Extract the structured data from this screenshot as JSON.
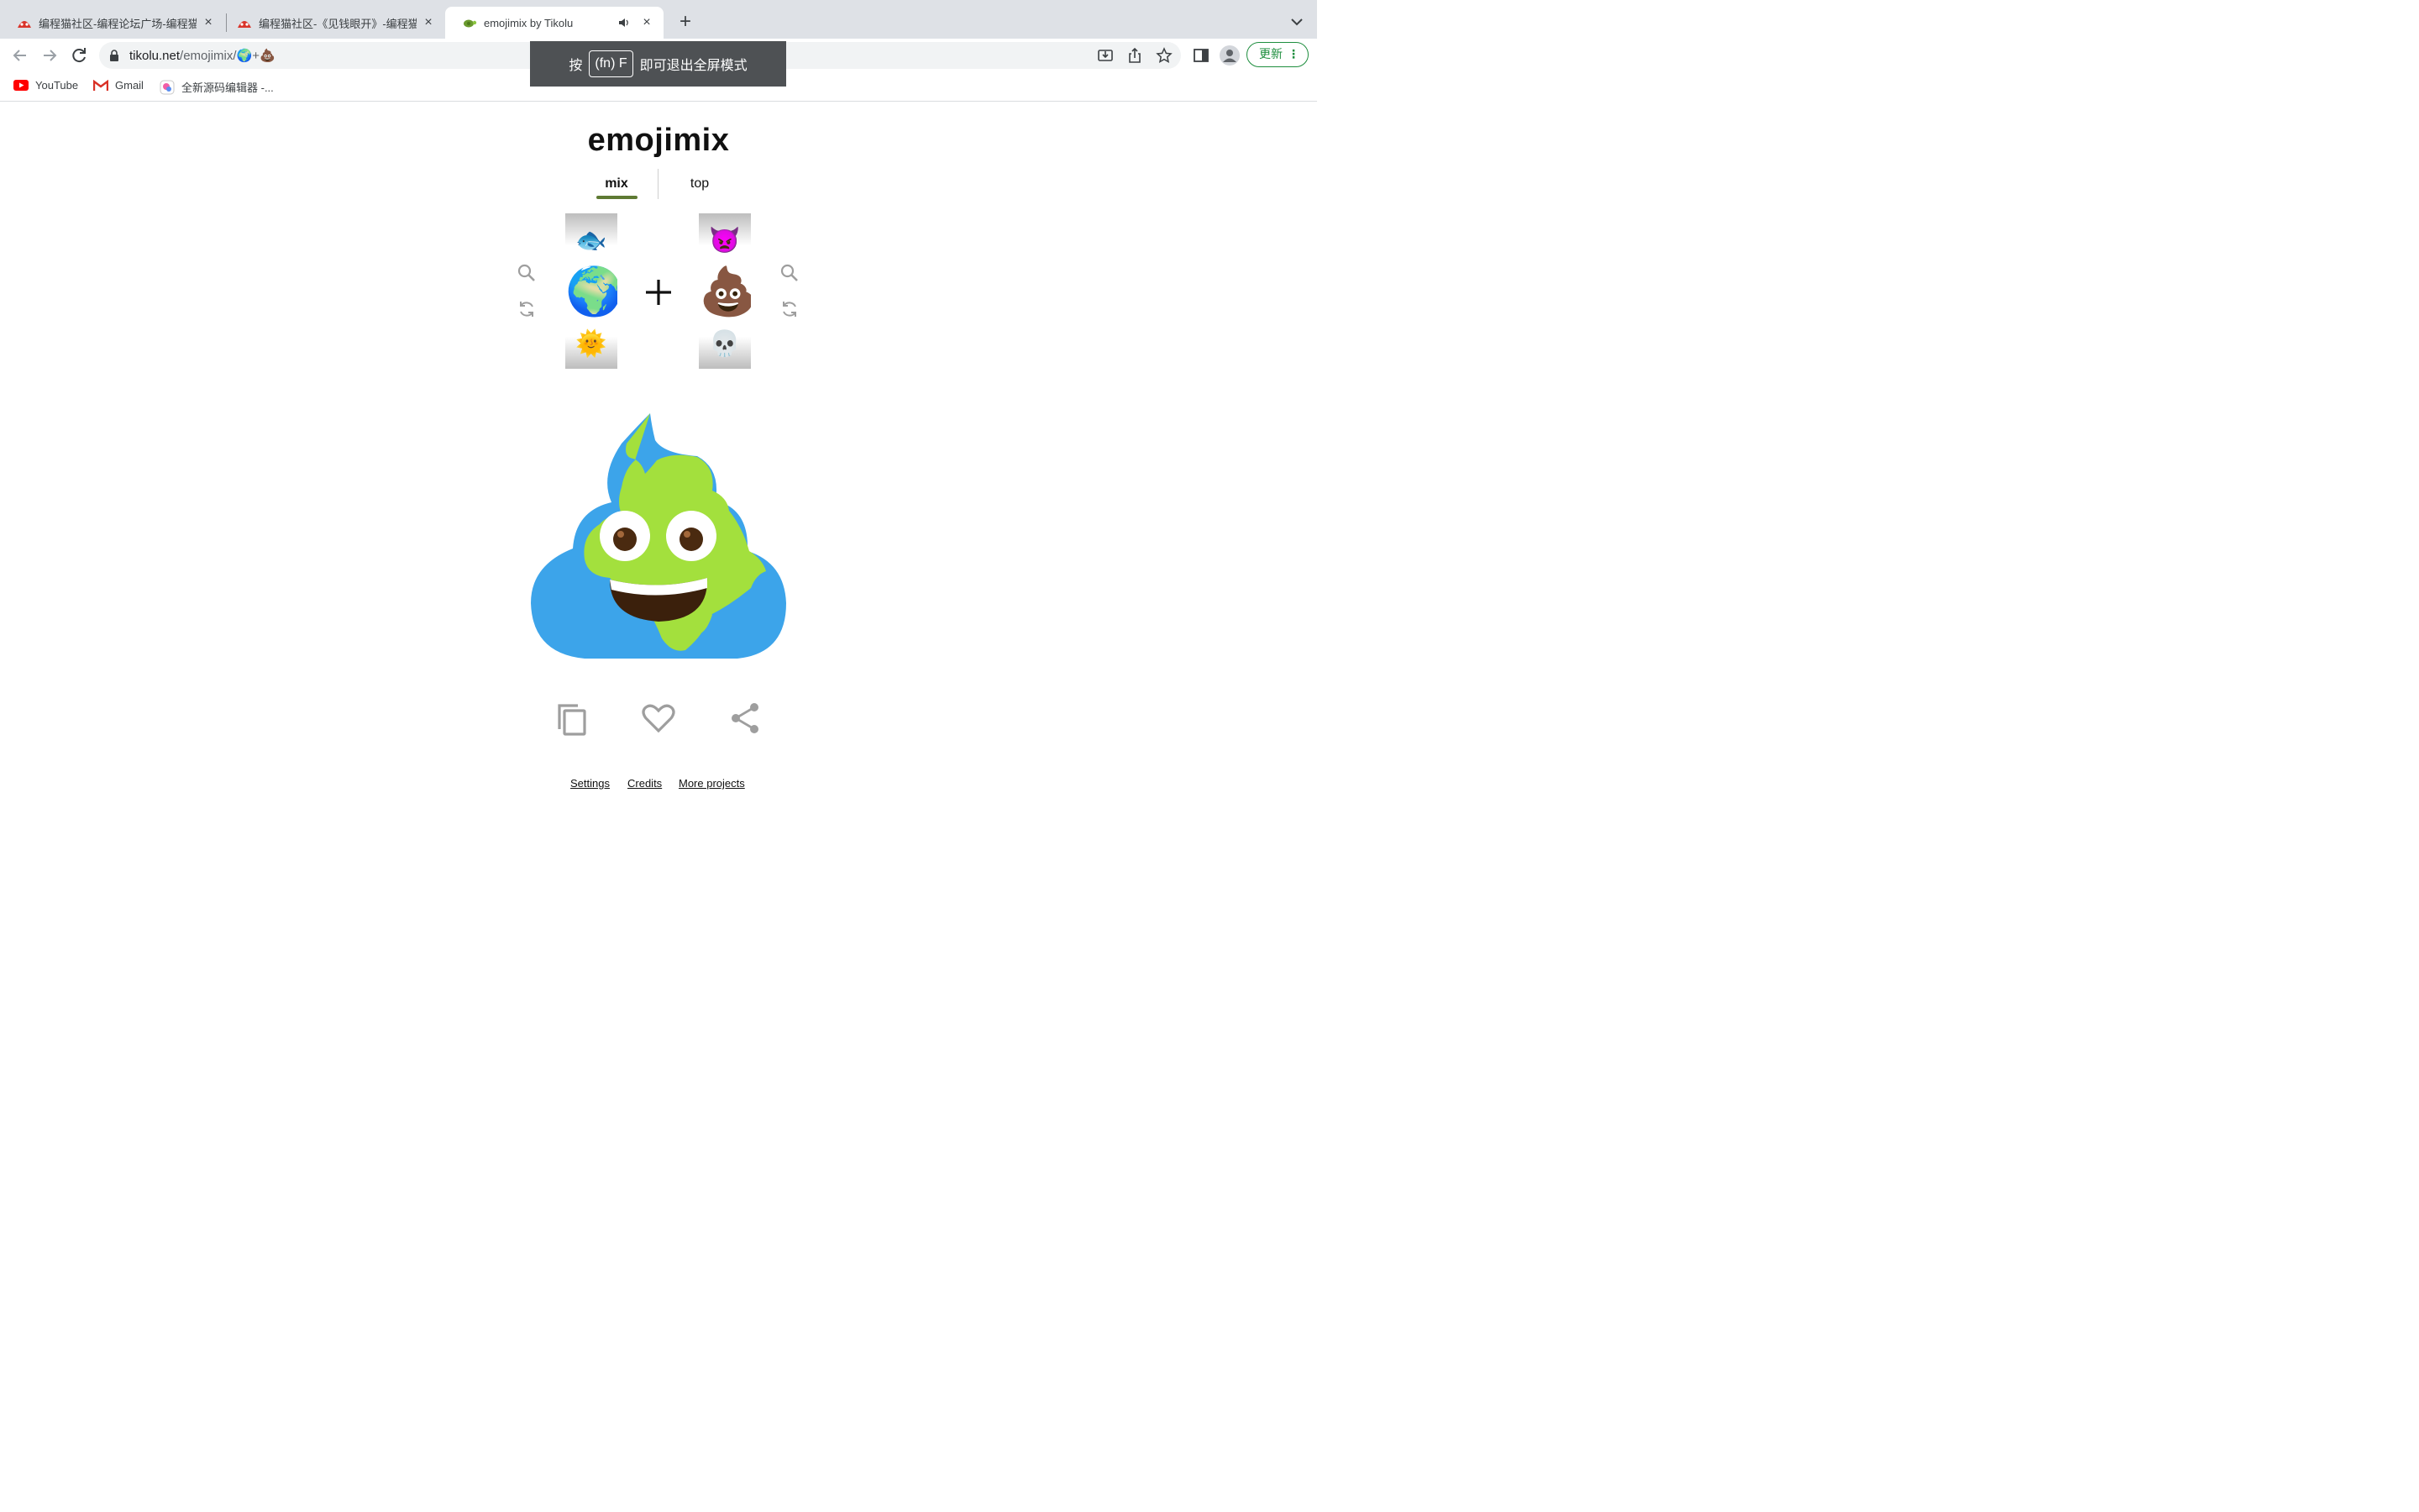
{
  "browser": {
    "tabs": [
      {
        "title": "编程猫社区-编程论坛广场-编程猫",
        "favicon": "codemao-icon",
        "active": false
      },
      {
        "title": "编程猫社区-《见钱眼开》-编程猫",
        "favicon": "codemao-icon",
        "active": false
      },
      {
        "title": "emojimix by Tikolu",
        "favicon": "turtle-icon",
        "active": true
      }
    ],
    "new_tab_label": "+",
    "close_label": "×",
    "url_host": "tikolu.net",
    "url_path": "/emojimix/🌍+💩",
    "update_label": "更新",
    "menu_label": "⋮",
    "bookmarks": [
      {
        "label": "YouTube",
        "icon": "youtube-icon"
      },
      {
        "label": "Gmail",
        "icon": "gmail-icon"
      },
      {
        "label": "全新源码编辑器 -...",
        "icon": "editor-icon"
      }
    ],
    "fullscreen_toast": {
      "prefix": "按",
      "key": "(fn) F",
      "suffix": "即可退出全屏模式"
    }
  },
  "page": {
    "title": "emojimix",
    "nav": {
      "mix": "mix",
      "top": "top"
    },
    "left_reel": {
      "above": "🐟",
      "selected": "🌍",
      "below": "🌞"
    },
    "right_reel": {
      "above": "👿",
      "selected": "💩",
      "below": "💀"
    },
    "footer": {
      "settings": "Settings",
      "credits": "Credits",
      "more": "More projects"
    }
  },
  "colors": {
    "accent_green": "#5e7a33",
    "update_green": "#1e8e3e",
    "icon_gray": "#9e9e9e",
    "ocean_blue": "#3ca4ea",
    "land_green": "#a3e03d",
    "mouth_brown": "#3b200c"
  }
}
